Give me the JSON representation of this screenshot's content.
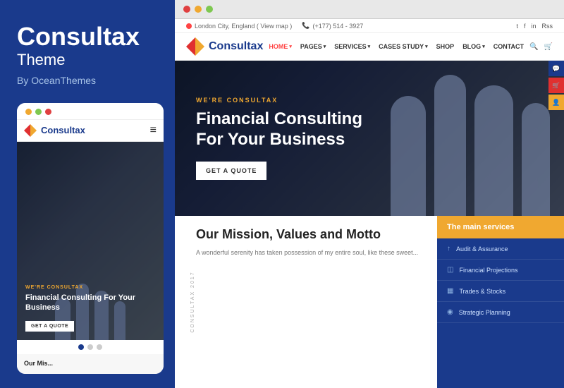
{
  "left": {
    "title": "Consultax",
    "subtitle": "Theme",
    "author": "By OceanThemes"
  },
  "mobile": {
    "logo": "Consultax",
    "hero_tag": "WE'RE CONSULTAX",
    "hero_title": "Financial Consulting For Your Business",
    "cta": "GET A QUOTE",
    "mission_title": "Our Mis...",
    "dots": [
      "#e74c3c",
      "#e0e0e0",
      "#e0e0e0"
    ]
  },
  "browser": {
    "dots": [
      "#f0a830",
      "#7ec850",
      "#e04040"
    ]
  },
  "topbar": {
    "location": "London City, England ( View map )",
    "phone": "(+177) 514 - 3927",
    "social": [
      "t",
      "f",
      "in",
      "Rss"
    ]
  },
  "nav": {
    "logo": "Consultax",
    "items": [
      {
        "label": "HOME",
        "active": true,
        "caret": true
      },
      {
        "label": "PAGES",
        "active": false,
        "caret": true
      },
      {
        "label": "SERVICES",
        "active": false,
        "caret": true
      },
      {
        "label": "CASES STUDY",
        "active": false,
        "caret": true
      },
      {
        "label": "SHOP",
        "active": false,
        "caret": false
      },
      {
        "label": "BLOG",
        "active": false,
        "caret": true
      },
      {
        "label": "CONTACT",
        "active": false,
        "caret": false
      }
    ]
  },
  "hero": {
    "tag": "WE'RE CONSULTAX",
    "title": "Financial Consulting For Your Business",
    "cta": "GET A QUOTE"
  },
  "mission": {
    "rotated_label": "CONSULTAX 2017",
    "title": "Our Mission, Values and Motto",
    "text": "A wonderful serenity has taken possession of my entire soul, like these sweet..."
  },
  "services": {
    "header": "The main services",
    "items": [
      {
        "icon": "↑",
        "name": "Audit & Assurance"
      },
      {
        "icon": "◫",
        "name": "Financial Projections"
      },
      {
        "icon": "▦",
        "name": "Trades & Stocks"
      },
      {
        "icon": "◉",
        "name": "Strategic Planning"
      }
    ]
  }
}
